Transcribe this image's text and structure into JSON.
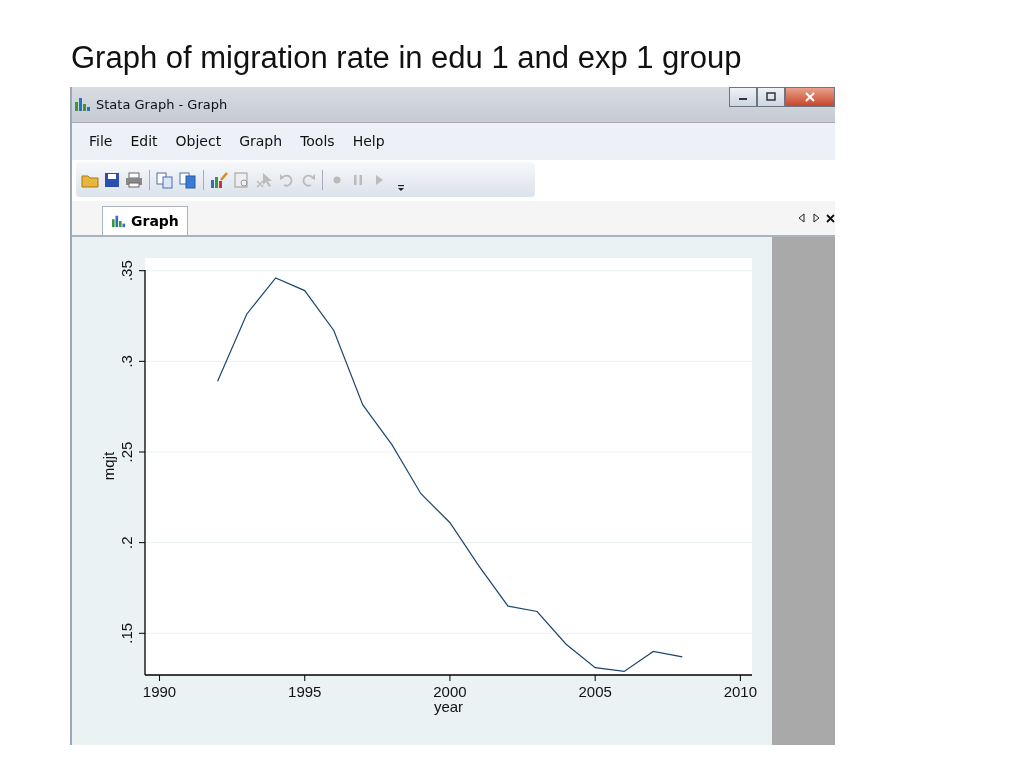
{
  "slide": {
    "title": "Graph of migration rate in edu 1 and exp 1 group"
  },
  "window": {
    "title": "Stata Graph - Graph"
  },
  "menu": [
    "File",
    "Edit",
    "Object",
    "Graph",
    "Tools",
    "Help"
  ],
  "tabs": [
    {
      "label": "Graph",
      "selected": true
    }
  ],
  "graph": {
    "chart_data": {
      "type": "line",
      "xlabel": "year",
      "ylabel": "mqjt",
      "x": [
        1992,
        1993,
        1994,
        1995,
        1996,
        1997,
        1998,
        1999,
        2000,
        2001,
        2002,
        2003,
        2004,
        2005,
        2006,
        2007,
        2008
      ],
      "series": [
        {
          "color": "#1a476f",
          "values": [
            0.289,
            0.326,
            0.346,
            0.339,
            0.317,
            0.276,
            0.254,
            0.227,
            0.211,
            0.187,
            0.165,
            0.162,
            0.144,
            0.131,
            0.129,
            0.14,
            0.137
          ]
        }
      ],
      "xlim": [
        1989.5,
        2010.4
      ],
      "ylim": [
        0.127,
        0.357
      ],
      "grid": true,
      "xticks": [
        1990,
        1995,
        2000,
        2005,
        2010
      ],
      "yticks": [
        {
          "value": 0.15,
          "label": ".15"
        },
        {
          "value": 0.2,
          "label": ".2"
        },
        {
          "value": 0.25,
          "label": ".25"
        },
        {
          "value": 0.3,
          "label": ".3"
        },
        {
          "value": 0.35,
          "label": ".35"
        }
      ]
    }
  }
}
